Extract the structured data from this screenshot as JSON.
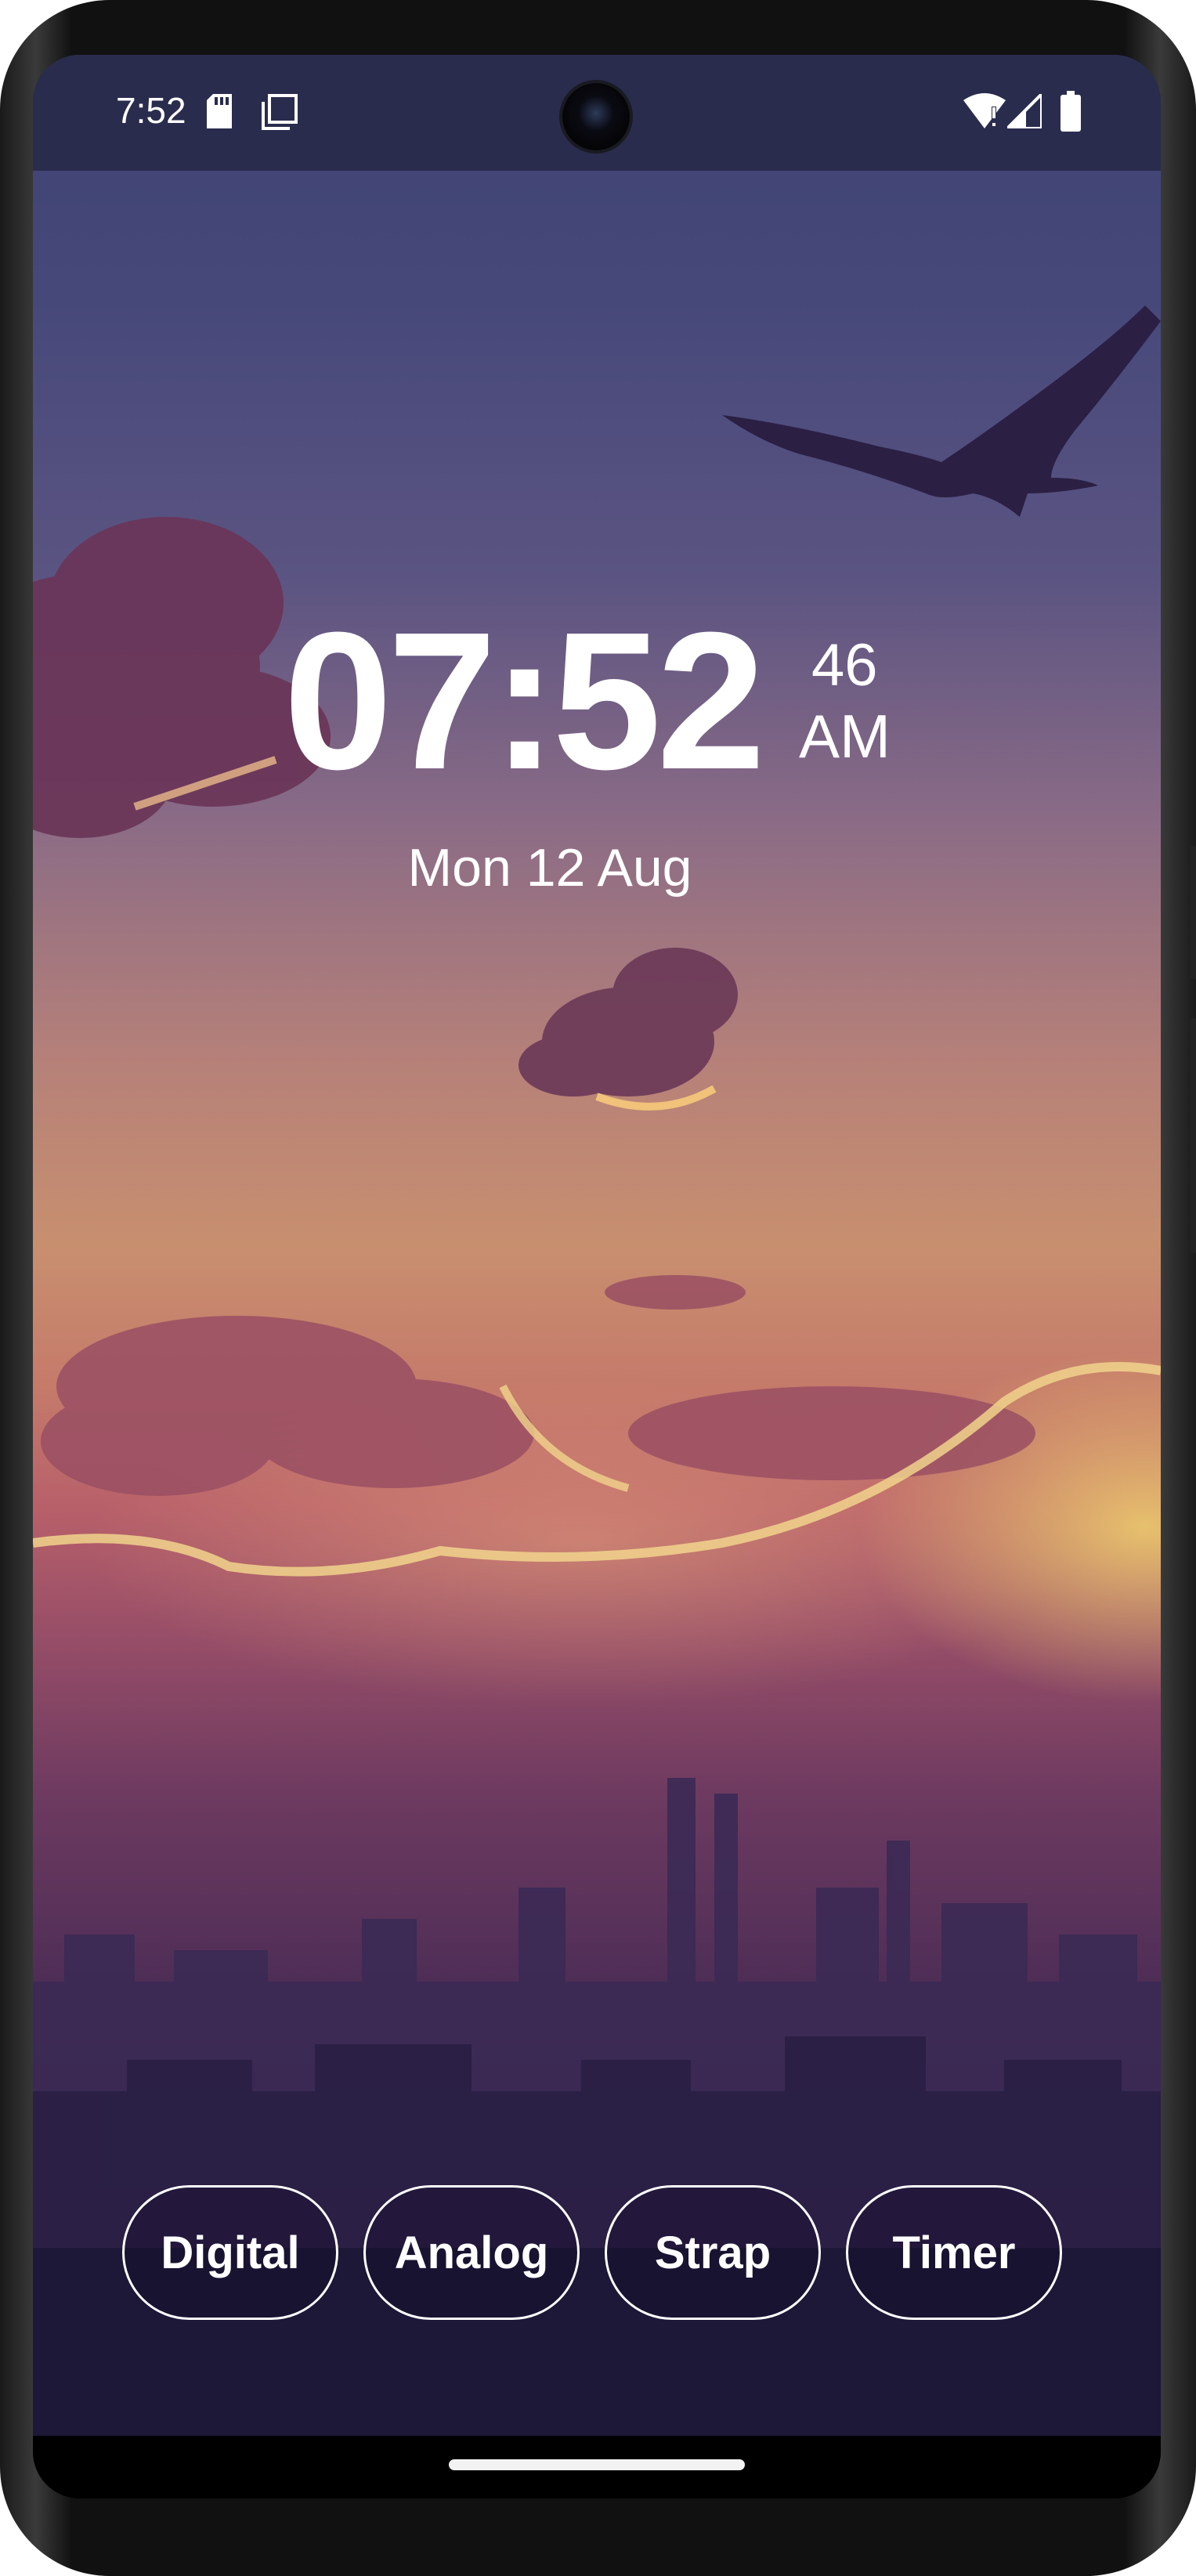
{
  "status_bar": {
    "time": "7:52",
    "left_icons": [
      "sd-card-icon",
      "screen-copy-icon"
    ],
    "right_icons": [
      "wifi-alert-icon",
      "cell-signal-icon",
      "battery-icon"
    ]
  },
  "clock": {
    "time": "07:52",
    "seconds": "46",
    "ampm": "AM",
    "date": "Mon 12 Aug"
  },
  "modes": [
    {
      "label": "Digital"
    },
    {
      "label": "Analog"
    },
    {
      "label": "Strap"
    },
    {
      "label": "Timer"
    }
  ],
  "colors": {
    "status_bar_bg": "#2a2c4e",
    "text": "#ffffff",
    "sky_top": "#3d4270",
    "sky_horizon": "#c88f6f",
    "city_bottom": "#1f1a3d"
  }
}
